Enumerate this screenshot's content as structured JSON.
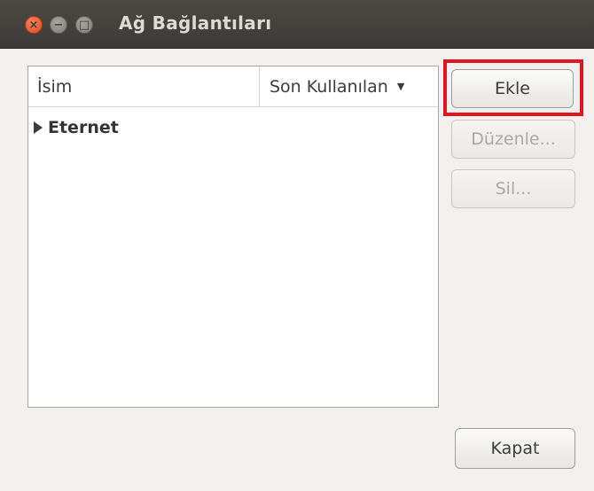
{
  "window": {
    "title": "Ağ Bağlantıları",
    "controls": {
      "close_glyph": "×",
      "minimize_glyph": "−",
      "maximize_glyph": "□"
    }
  },
  "connections_list": {
    "columns": {
      "name": "İsim",
      "last_used": "Son Kullanılan",
      "sort_glyph": "▼"
    },
    "groups": [
      {
        "label": "Eternet",
        "expanded": false
      }
    ]
  },
  "buttons": {
    "add": "Ekle",
    "edit": "Düzenle...",
    "delete": "Sil...",
    "close": "Kapat"
  },
  "colors": {
    "highlight_frame": "#e3151f",
    "titlebar": "#3b3a36",
    "close_button": "#dd4b20"
  },
  "icons": {
    "close": "close-icon",
    "minimize": "minimize-icon",
    "maximize": "maximize-icon",
    "expander": "triangle-right-icon",
    "sort": "chevron-down-icon"
  }
}
